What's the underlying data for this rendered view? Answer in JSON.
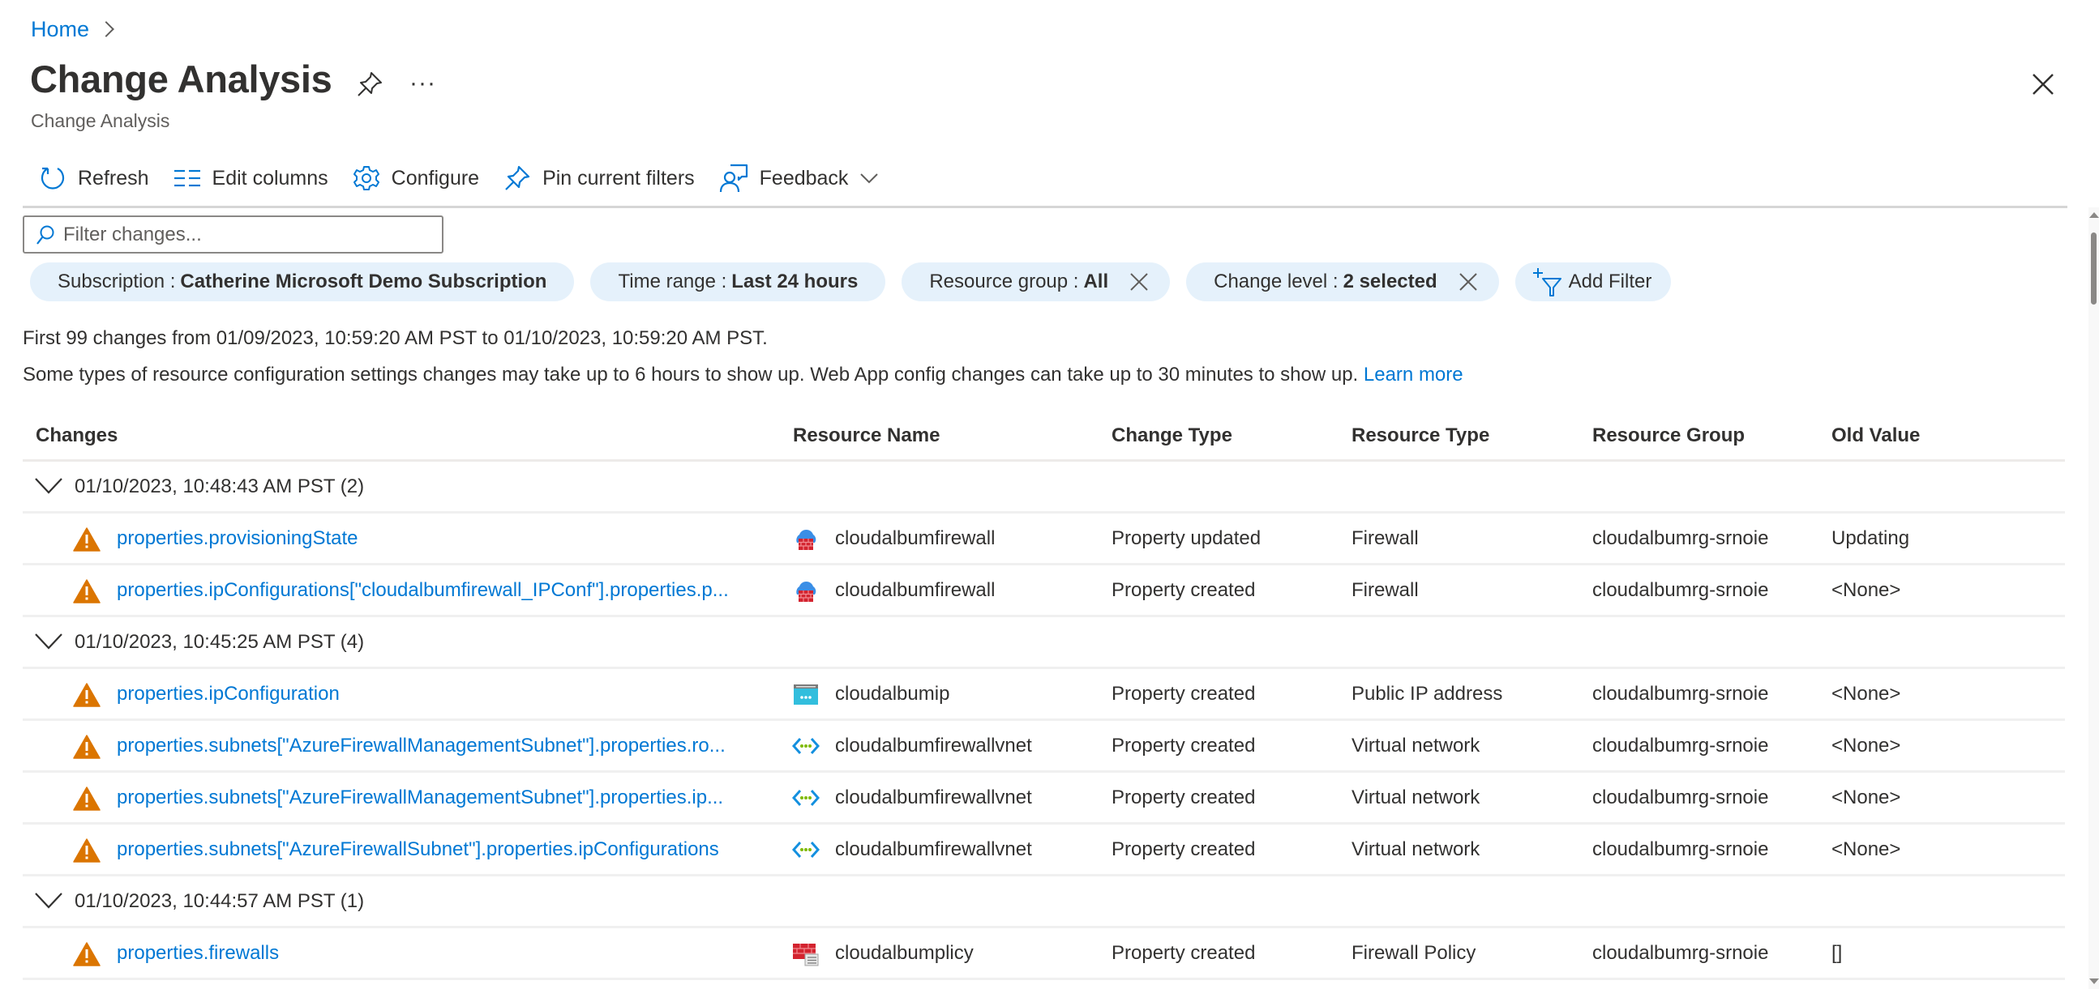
{
  "breadcrumb": {
    "home": "Home"
  },
  "header": {
    "title": "Change Analysis",
    "subtitle": "Change Analysis",
    "more": "···"
  },
  "toolbar": {
    "refresh": "Refresh",
    "edit_columns": "Edit columns",
    "configure": "Configure",
    "pin_filters": "Pin current filters",
    "feedback": "Feedback"
  },
  "search": {
    "placeholder": "Filter changes...",
    "value": ""
  },
  "filters": [
    {
      "label": "Subscription :",
      "value": "Catherine Microsoft Demo Subscription",
      "removable": false
    },
    {
      "label": "Time range :",
      "value": "Last 24 hours",
      "removable": false
    },
    {
      "label": "Resource group :",
      "value": "All",
      "removable": true
    },
    {
      "label": "Change level :",
      "value": "2 selected",
      "removable": true
    }
  ],
  "add_filter": "Add Filter",
  "info": {
    "line1": "First 99 changes from 01/09/2023, 10:59:20 AM PST to 01/10/2023, 10:59:20 AM PST.",
    "line2": "Some types of resource configuration settings changes may take up to 6 hours to show up. Web App config changes can take up to 30 minutes to show up.",
    "learn_more": "Learn more"
  },
  "table": {
    "columns": [
      "Changes",
      "Resource Name",
      "Change Type",
      "Resource Type",
      "Resource Group",
      "Old Value"
    ],
    "groups": [
      {
        "label": "01/10/2023, 10:48:43 AM PST (2)",
        "rows": [
          {
            "change": "properties.provisioningState",
            "resource_icon": "firewall-icon",
            "resource_name": "cloudalbumfirewall",
            "change_type": "Property updated",
            "resource_type": "Firewall",
            "resource_group": "cloudalbumrg-srnoie",
            "old_value": "Updating"
          },
          {
            "change": "properties.ipConfigurations[\"cloudalbumfirewall_IPConf\"].properties.p...",
            "resource_icon": "firewall-icon",
            "resource_name": "cloudalbumfirewall",
            "change_type": "Property created",
            "resource_type": "Firewall",
            "resource_group": "cloudalbumrg-srnoie",
            "old_value": "<None>"
          }
        ]
      },
      {
        "label": "01/10/2023, 10:45:25 AM PST (4)",
        "rows": [
          {
            "change": "properties.ipConfiguration",
            "resource_icon": "public-ip-icon",
            "resource_name": "cloudalbumip",
            "change_type": "Property created",
            "resource_type": "Public IP address",
            "resource_group": "cloudalbumrg-srnoie",
            "old_value": "<None>"
          },
          {
            "change": "properties.subnets[\"AzureFirewallManagementSubnet\"].properties.ro...",
            "resource_icon": "virtual-network-icon",
            "resource_name": "cloudalbumfirewallvnet",
            "change_type": "Property created",
            "resource_type": "Virtual network",
            "resource_group": "cloudalbumrg-srnoie",
            "old_value": "<None>"
          },
          {
            "change": "properties.subnets[\"AzureFirewallManagementSubnet\"].properties.ip...",
            "resource_icon": "virtual-network-icon",
            "resource_name": "cloudalbumfirewallvnet",
            "change_type": "Property created",
            "resource_type": "Virtual network",
            "resource_group": "cloudalbumrg-srnoie",
            "old_value": "<None>"
          },
          {
            "change": "properties.subnets[\"AzureFirewallSubnet\"].properties.ipConfigurations",
            "resource_icon": "virtual-network-icon",
            "resource_name": "cloudalbumfirewallvnet",
            "change_type": "Property created",
            "resource_type": "Virtual network",
            "resource_group": "cloudalbumrg-srnoie",
            "old_value": "<None>"
          }
        ]
      },
      {
        "label": "01/10/2023, 10:44:57 AM PST (1)",
        "rows": [
          {
            "change": "properties.firewalls",
            "resource_icon": "firewall-policy-icon",
            "resource_name": "cloudalbumplicy",
            "change_type": "Property created",
            "resource_type": "Firewall Policy",
            "resource_group": "cloudalbumrg-srnoie",
            "old_value": "[]"
          }
        ]
      }
    ]
  },
  "colors": {
    "accent": "#0078d4",
    "pill_bg": "#e5f1fb",
    "warning": "#db7500",
    "text": "#323130"
  }
}
